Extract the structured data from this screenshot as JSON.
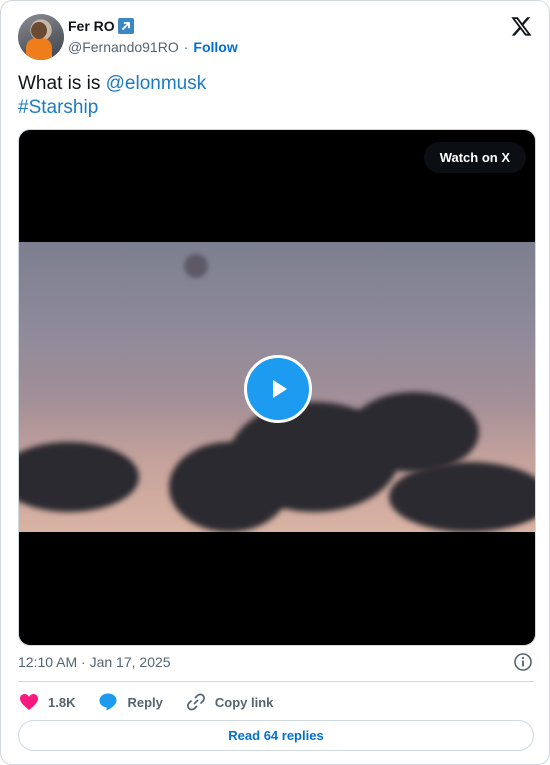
{
  "author": {
    "name": "Fer RO",
    "badge_icon": "arrow-up-right-icon",
    "handle": "@Fernando91RO",
    "separator": "·",
    "follow_label": "Follow"
  },
  "tweet": {
    "text_prefix": "What is is ",
    "mention": "@elonmusk",
    "hashtag": "#Starship"
  },
  "media": {
    "watch_label": "Watch on X",
    "play_icon": "play-icon"
  },
  "meta": {
    "timestamp": "12:10 AM · Jan 17, 2025",
    "info_icon": "info-icon"
  },
  "actions": {
    "like_count": "1.8K",
    "reply_label": "Reply",
    "copy_label": "Copy link"
  },
  "read_replies_label": "Read 64 replies",
  "colors": {
    "link": "#1d7bc6",
    "follow": "#006fd6",
    "like": "#f91880",
    "reply": "#1d9bf0",
    "play": "#1d9bf0"
  }
}
